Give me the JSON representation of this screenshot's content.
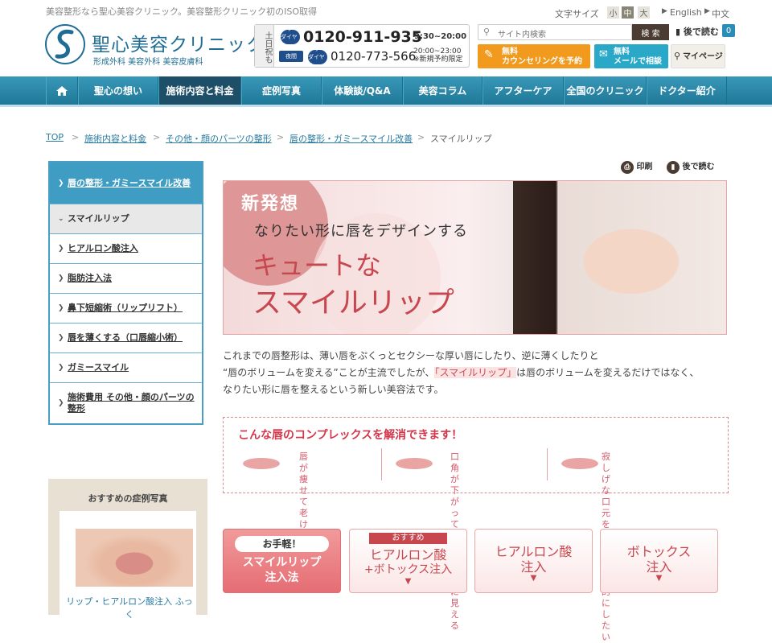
{
  "header": {
    "tagline": "美容整形なら聖心美容クリニック。美容整形クリニック初のISO取得",
    "logo_title": "聖心美容クリニック",
    "logo_sub": "形成外科 美容外科 美容皮膚科",
    "phone_side": "土日祝も",
    "free_dial_badge": "フリーダイヤル",
    "phone1": "0120-911-935",
    "hours1": "9:30~20:00",
    "night_label": "夜間",
    "phone2": "0120-773-566",
    "hours2_line1": "20:00~23:00",
    "hours2_line2": "※新規予約限定",
    "font_size_label": "文字サイズ",
    "font_sizes": [
      "小",
      "中",
      "大"
    ],
    "lang_en": "English",
    "lang_zh": "中文",
    "search_placeholder": "サイト内検索",
    "search_button": "検 索",
    "later_label": "後で読む",
    "later_count": "0",
    "cta_counsel_line1": "無料",
    "cta_counsel_line2": "カウンセリングを予約",
    "cta_mail_line1": "無料",
    "cta_mail_line2": "メールで相談",
    "cta_mypage": "マイページ"
  },
  "nav": [
    "聖心の想い",
    "施術内容と料金",
    "症例写真",
    "体験談/Q&A",
    "美容コラム",
    "アフターケア",
    "全国のクリニック",
    "ドクター紹介"
  ],
  "breadcrumb": [
    "TOP",
    "施術内容と料金",
    "その他・顔のパーツの整形",
    "唇の整形・ガミースマイル改善",
    "スマイルリップ"
  ],
  "sidebar": {
    "items": [
      "唇の整形・ガミースマイル改善",
      "スマイルリップ",
      "ヒアルロン酸注入",
      "脂肪注入法",
      "鼻下短縮術（リップリフト）",
      "唇を薄くする（口唇縮小術）",
      "ガミースマイル",
      "施術費用 その他・顔のパーツの整形"
    ],
    "reco_title": "おすすめの症例写真",
    "reco_caption": "リップ・ヒアルロン酸注入 ふっく"
  },
  "tools": {
    "print": "印刷",
    "later": "後で読む"
  },
  "hero": {
    "new": "新発想",
    "sub": "なりたい形に唇をデザインする",
    "big1": "キュートな",
    "big2": "スマイルリップ"
  },
  "intro": {
    "line1": "これまでの唇整形は、薄い唇をぷくっとセクシーな厚い唇にしたり、逆に薄くしたりと",
    "line2a": "“唇のボリュームを変える”ことが主流でしたが、",
    "line2b": "「スマイルリップ」",
    "line2c": "は唇のボリュームを変えるだけではなく、",
    "line3": "なりたい形に唇を整えるという新しい美容法です。"
  },
  "complex": {
    "title": "こんな唇のコンプレックスを解消できます！",
    "items": [
      {
        "l1": "唇が痩せて",
        "l2": "老け顔に見える"
      },
      {
        "l1": "口角が下がって",
        "l2": "不機嫌そうに見える"
      },
      {
        "l1": "寂しげな口元を",
        "l2": "もっと印象的にしたい"
      }
    ]
  },
  "buttons": {
    "b1_badge": "お手軽！",
    "b1_l1": "スマイルリップ",
    "b1_l2": "注入法",
    "b2_badge": "おすすめ",
    "b2_l1": "ヒアルロン酸",
    "b2_l2": "+ボトックス注入",
    "b3_l1": "ヒアルロン酸",
    "b3_l2": "注入",
    "b4_l1": "ボトックス",
    "b4_l2": "注入"
  },
  "colors": {
    "brand_blue": "#1f6d94",
    "nav": "#2a88a8",
    "accent_pink": "#c8464e",
    "orange": "#f29a1e"
  }
}
